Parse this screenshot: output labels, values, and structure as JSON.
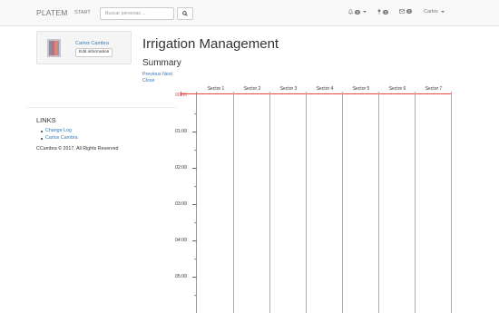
{
  "navbar": {
    "brand": "PLATEM",
    "start_label": "START",
    "search_placeholder": "Buscar personas ...",
    "alerts_count": "0",
    "tasks_count": "0",
    "messages_count": "0",
    "user_name": "Carlos"
  },
  "profile": {
    "name": "Carlos Cambra",
    "edit_label": "Edit information"
  },
  "sidebar": {
    "links_title": "LINKS",
    "links": [
      "Change Log",
      "Carlos Cambra"
    ],
    "copyright": "CCambra © 2017. All Rights Reserved"
  },
  "main": {
    "title": "Irrigation Management",
    "summary_title": "Summary",
    "previous_label": "Previous",
    "next_label": "Next",
    "close_label": "Close"
  },
  "schedule": {
    "sectors": [
      "Sector 1",
      "Sector 2",
      "Sector 3",
      "Sector 4",
      "Sector 5",
      "Sector 6",
      "Sector 7"
    ],
    "time_labels": [
      "00:00",
      "01:00",
      "02:00",
      "03:00",
      "04:00",
      "05:00"
    ],
    "current_time": "00:00"
  },
  "colors": {
    "link": "#337ab7",
    "now_line": "#e84a4a",
    "navbar_bg": "#f8f8f8"
  }
}
